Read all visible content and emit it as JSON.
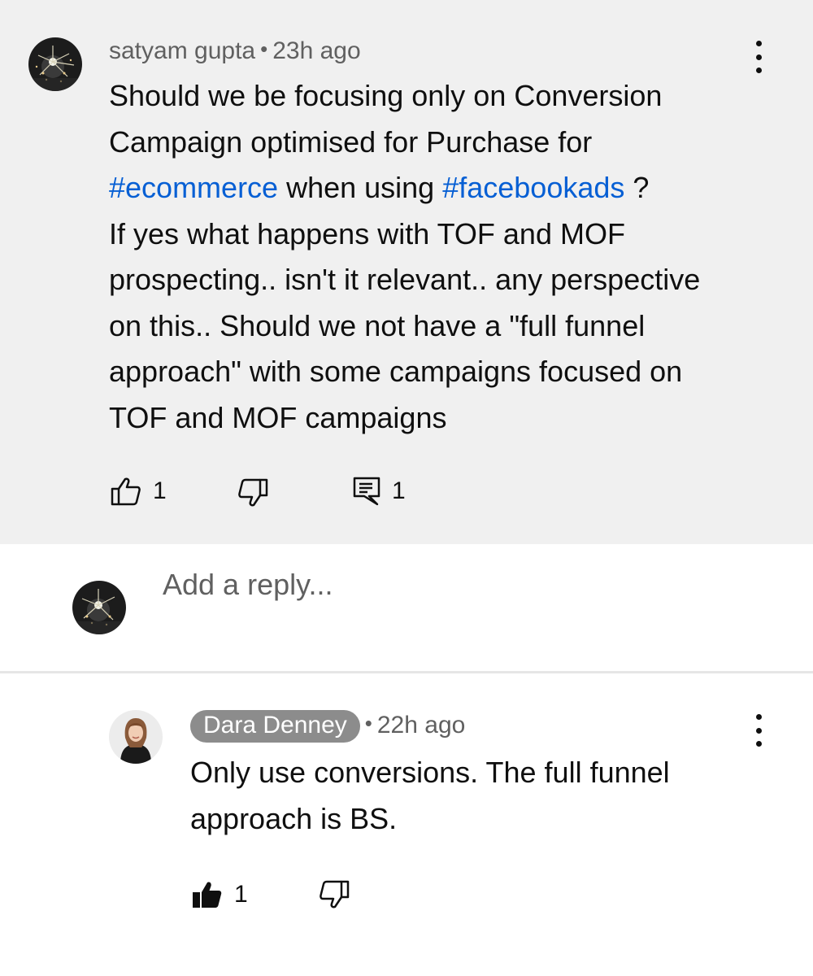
{
  "comment": {
    "author": "satyam gupta",
    "separator": "•",
    "time": "23h ago",
    "text_line1": "Should we be focusing only on Conversion",
    "text_line2": "Campaign optimised for Purchase for",
    "hashtag1": "#ecommerce",
    "text_mid": " when using ",
    "hashtag2": "#facebookads",
    "text_end": " ?",
    "text_line4": "If yes what happens with TOF and MOF",
    "text_line5": "prospecting.. isn't it relevant.. any perspective",
    "text_line6": "on this.. Should we not have a \"full funnel",
    "text_line7": "approach\" with some campaigns focused on",
    "text_line8": "TOF and MOF campaigns",
    "like_count": "1",
    "reply_count": "1",
    "icons": {
      "avatar": "avatar",
      "more": "more-vert-icon",
      "like": "thumb-up-outline-icon",
      "dislike": "thumb-down-outline-icon",
      "reply": "comment-reply-icon"
    }
  },
  "reply_input": {
    "placeholder": "Add a reply..."
  },
  "reply": {
    "author": "Dara Denney",
    "separator": "•",
    "time": "22h ago",
    "text_line1": "Only use conversions. The full funnel",
    "text_line2": "approach is BS.",
    "like_count": "1",
    "icons": {
      "avatar": "avatar",
      "more": "more-vert-icon",
      "like": "thumb-up-filled-icon",
      "dislike": "thumb-down-outline-icon"
    }
  },
  "colors": {
    "comment_background": "#f0f0f0",
    "hashtag": "#065fd4",
    "meta_text": "#606060",
    "author_chip": "#8c8c8c"
  }
}
